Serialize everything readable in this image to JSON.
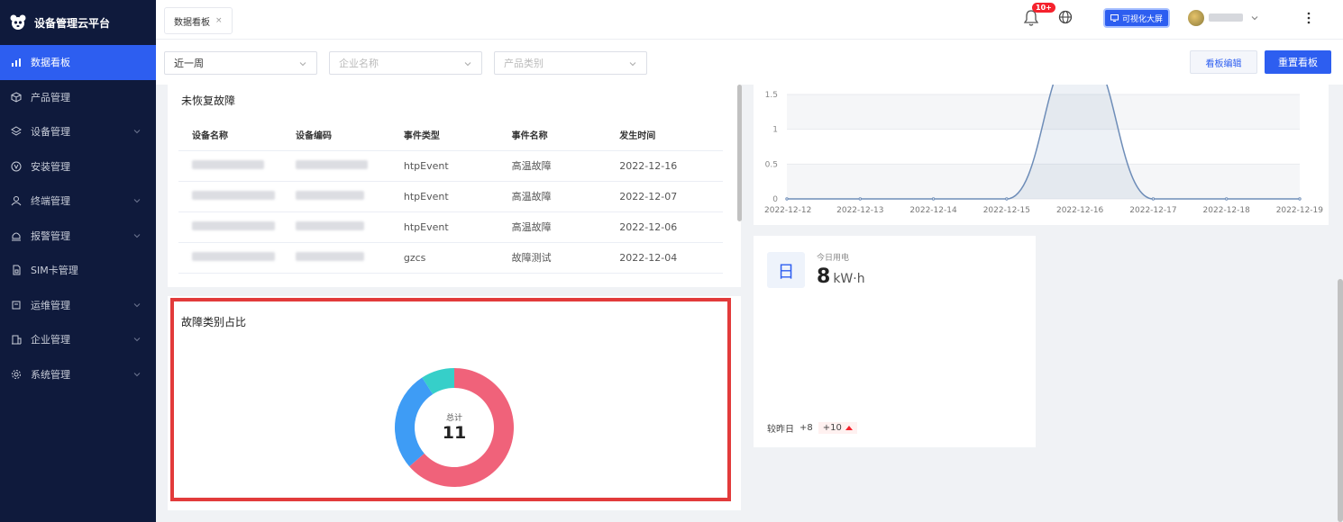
{
  "app": {
    "title": "设备管理云平台"
  },
  "sidebar": {
    "items": [
      {
        "label": "数据看板",
        "icon": "bar-chart-icon",
        "active": true,
        "has_children": false
      },
      {
        "label": "产品管理",
        "icon": "cube-icon",
        "active": false,
        "has_children": false
      },
      {
        "label": "设备管理",
        "icon": "layers-icon",
        "active": false,
        "has_children": true
      },
      {
        "label": "安装管理",
        "icon": "install-icon",
        "active": false,
        "has_children": false
      },
      {
        "label": "终端管理",
        "icon": "user-icon",
        "active": false,
        "has_children": true
      },
      {
        "label": "报警管理",
        "icon": "alarm-icon",
        "active": false,
        "has_children": true
      },
      {
        "label": "SIM卡管理",
        "icon": "sim-card-icon",
        "active": false,
        "has_children": false
      },
      {
        "label": "运维管理",
        "icon": "tool-icon",
        "active": false,
        "has_children": true
      },
      {
        "label": "企业管理",
        "icon": "building-icon",
        "active": false,
        "has_children": true
      },
      {
        "label": "系统管理",
        "icon": "settings-icon",
        "active": false,
        "has_children": true
      }
    ]
  },
  "topbar": {
    "tab_label": "数据看板",
    "tab_close": "×",
    "notification_badge": "10+",
    "big_screen_label": "可视化大屏"
  },
  "filters": {
    "period": "近一周",
    "company_placeholder": "企业名称",
    "product_placeholder": "产品类别",
    "edit_button": "看板编辑",
    "reset_button": "重置看板"
  },
  "fault_table": {
    "title": "未恢复故障",
    "columns": [
      "设备名称",
      "设备编码",
      "事件类型",
      "事件名称",
      "发生时间"
    ],
    "rows": [
      {
        "event_type": "htpEvent",
        "event_name": "高温故障",
        "time": "2022-12-16"
      },
      {
        "event_type": "htpEvent",
        "event_name": "高温故障",
        "time": "2022-12-07"
      },
      {
        "event_type": "htpEvent",
        "event_name": "高温故障",
        "time": "2022-12-06"
      },
      {
        "event_type": "gzcs",
        "event_name": "故障测试",
        "time": "2022-12-04"
      }
    ]
  },
  "fault_ratio": {
    "title": "故障类别占比",
    "total_label": "总计",
    "total_value": "11"
  },
  "power": {
    "icon_char": "日",
    "label": "今日用电",
    "value": "8",
    "unit": "kW·h",
    "compare_label": "较昨日",
    "compare_value": "+8",
    "delta_value": "+10"
  },
  "chart_data": [
    {
      "type": "pie",
      "title": "故障类别占比",
      "slices": [
        {
          "value": 7,
          "color": "#f0627a"
        },
        {
          "value": 3,
          "color": "#3e9cf5"
        },
        {
          "value": 1,
          "color": "#36cfc9"
        }
      ]
    },
    {
      "type": "area",
      "x": [
        "2022-12-12",
        "2022-12-13",
        "2022-12-14",
        "2022-12-15",
        "2022-12-16",
        "2022-12-17",
        "2022-12-18",
        "2022-12-19"
      ],
      "series": [
        {
          "values": [
            0,
            0,
            0,
            0,
            2.2,
            0,
            0,
            0
          ],
          "color": "#6e8db8"
        }
      ],
      "y_ticks": [
        "0",
        "0.5",
        "1",
        "1.5"
      ],
      "ylim": [
        0,
        1.5
      ],
      "grid": true
    }
  ]
}
